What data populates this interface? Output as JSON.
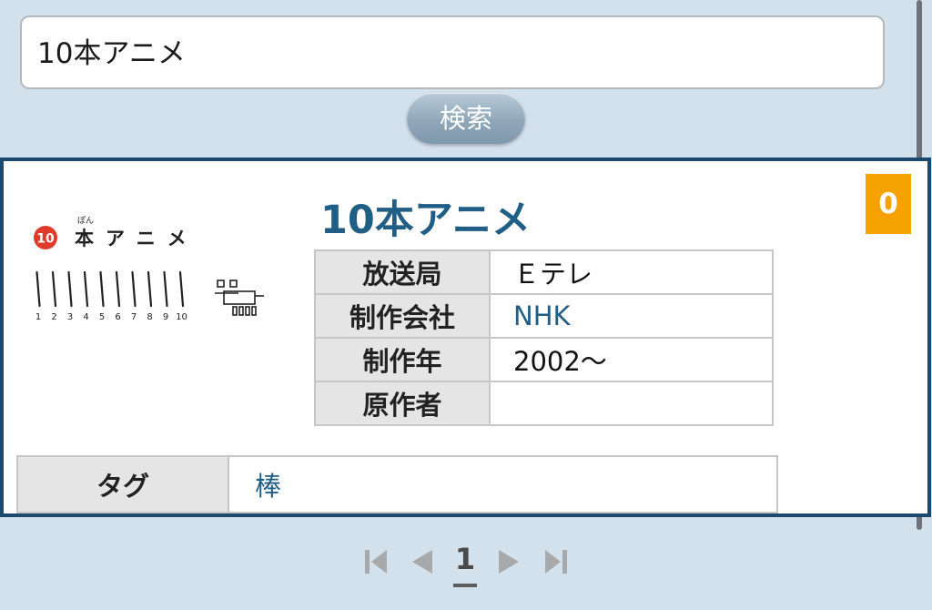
{
  "search": {
    "query": "10本アニメ",
    "button_label": "検索"
  },
  "result": {
    "title": "10本アニメ",
    "count": "0",
    "logo": {
      "badge_text": "10",
      "furigana": "ぽん",
      "name_text": "本アニメ",
      "numbers": [
        "1",
        "2",
        "3",
        "4",
        "5",
        "6",
        "7",
        "8",
        "9",
        "10"
      ]
    },
    "info": [
      {
        "label": "放送局",
        "value": "Ｅテレ"
      },
      {
        "label": "制作会社",
        "value": "NHK"
      },
      {
        "label": "制作年",
        "value": "2002～"
      },
      {
        "label": "原作者",
        "value": ""
      }
    ],
    "tags": {
      "label": "タグ",
      "value": "棒"
    }
  },
  "pagination": {
    "current_page": "1"
  },
  "colors": {
    "background": "#d3e1ec",
    "card_border": "#1c4a6e",
    "title": "#215e86",
    "badge": "#f5a100",
    "table_header": "#e5e5e5"
  }
}
